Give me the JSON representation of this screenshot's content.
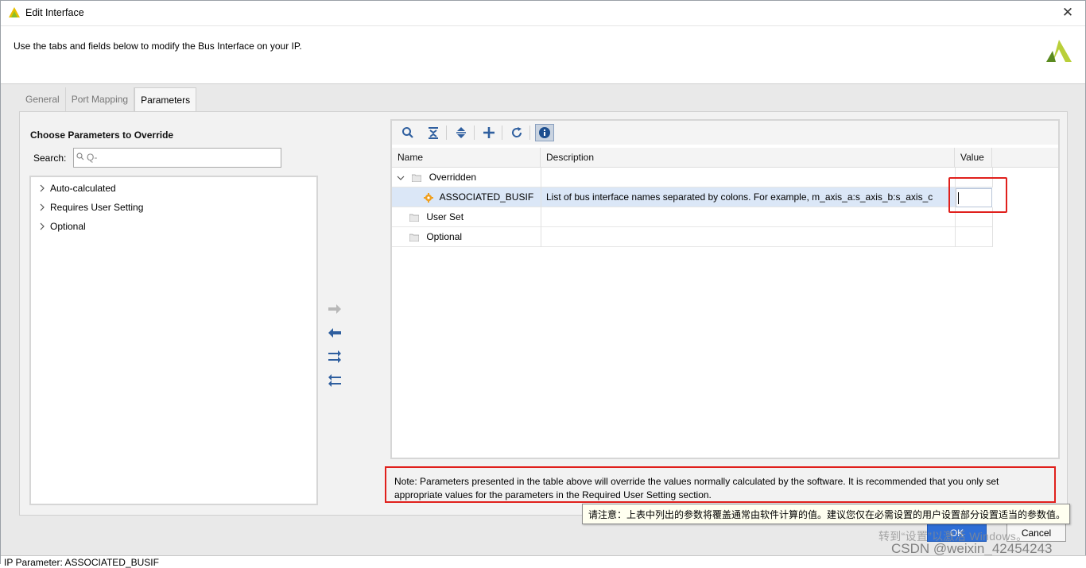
{
  "window": {
    "title": "Edit Interface",
    "close_glyph": "✕",
    "header_text": "Use the tabs and fields below to modify the Bus Interface on your IP."
  },
  "tabs": [
    {
      "label": "General"
    },
    {
      "label": "Port Mapping"
    },
    {
      "label": "Parameters"
    }
  ],
  "left_panel": {
    "title": "Choose Parameters to Override",
    "search_label": "Search:",
    "search_placeholder": "Q-",
    "tree": [
      {
        "label": "Auto-calculated"
      },
      {
        "label": "Requires User Setting"
      },
      {
        "label": "Optional"
      }
    ]
  },
  "toolbar": {
    "icons": [
      "search-icon",
      "collapse-all-icon",
      "expand-all-icon",
      "add-icon",
      "refresh-icon",
      "info-icon"
    ]
  },
  "table": {
    "columns": [
      "Name",
      "Description",
      "Value"
    ],
    "rows": [
      {
        "name": "Overridden",
        "description": "",
        "value": ""
      },
      {
        "name": "ASSOCIATED_BUSIF",
        "description": "List of bus interface names separated by colons. For example, m_axis_a:s_axis_b:s_axis_c",
        "value": ""
      },
      {
        "name": "User Set",
        "description": "",
        "value": ""
      },
      {
        "name": "Optional",
        "description": "",
        "value": ""
      }
    ]
  },
  "note": {
    "line1": "Note: Parameters presented in the table above will override the values normally calculated by the software. It is recommended that you only set",
    "line2": "appropriate values for the parameters in the Required User Setting section."
  },
  "tooltip": {
    "text": "请注意：上表中列出的参数将覆盖通常由软件计算的值。建议您仅在必需设置的用户设置部分设置适当的参数值。"
  },
  "buttons": {
    "ok": "OK",
    "cancel": "Cancel"
  },
  "overlay": {
    "watermark": "转到“设置”以激活 Windows。",
    "csdn": "CSDN @weixin_42454243"
  },
  "status": {
    "text": "IP Parameter: ASSOCIATED_BUSIF"
  },
  "colors": {
    "accent_blue": "#2f6fd6",
    "highlight_red": "#e0201c",
    "selected_row": "#dbe7f7",
    "gear_orange": "#f0a020"
  }
}
